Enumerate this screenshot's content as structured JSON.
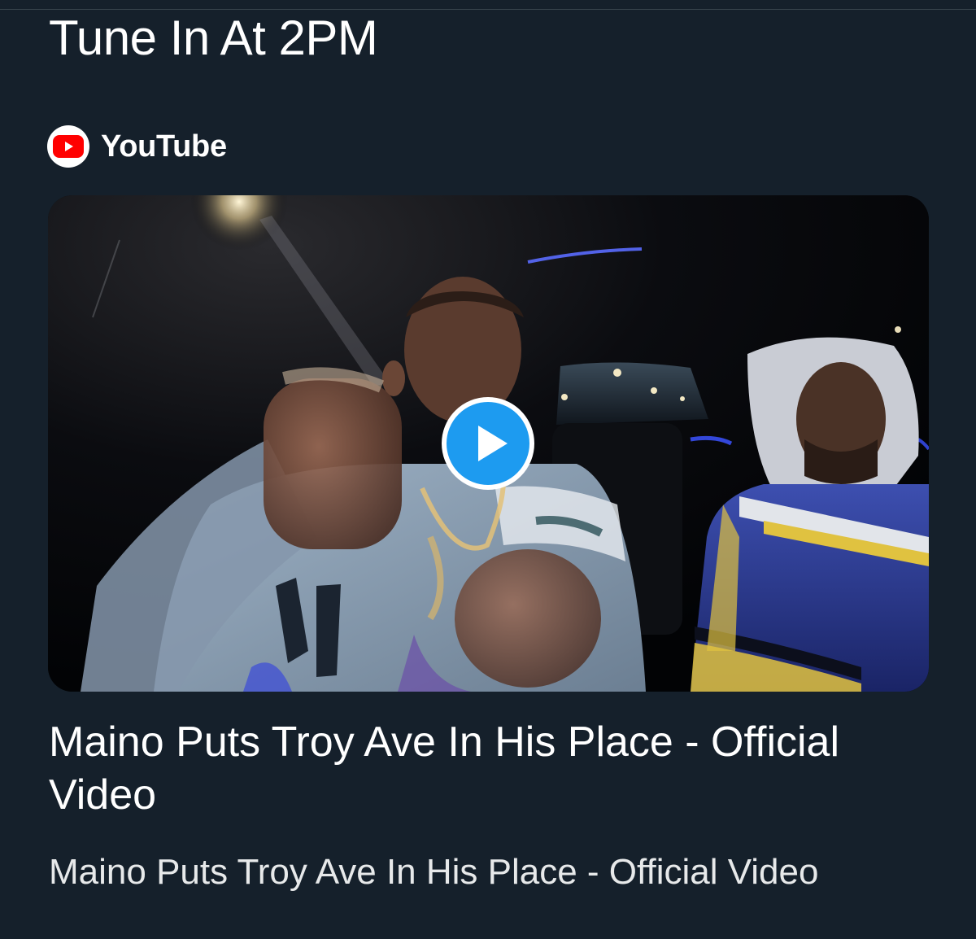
{
  "tweet": {
    "text": "Tune In At 2PM"
  },
  "card": {
    "source_name": "YouTube",
    "source_icon": "youtube-logo-icon",
    "title": "Maino Puts Troy Ave In His Place - Official Video",
    "description": "Maino Puts Troy Ave In His Place - Official Video",
    "play_icon": "play-icon"
  },
  "colors": {
    "background": "#15202b",
    "youtube_red": "#ff0000",
    "play_blue": "#1d9bf0",
    "text": "#ffffff"
  }
}
